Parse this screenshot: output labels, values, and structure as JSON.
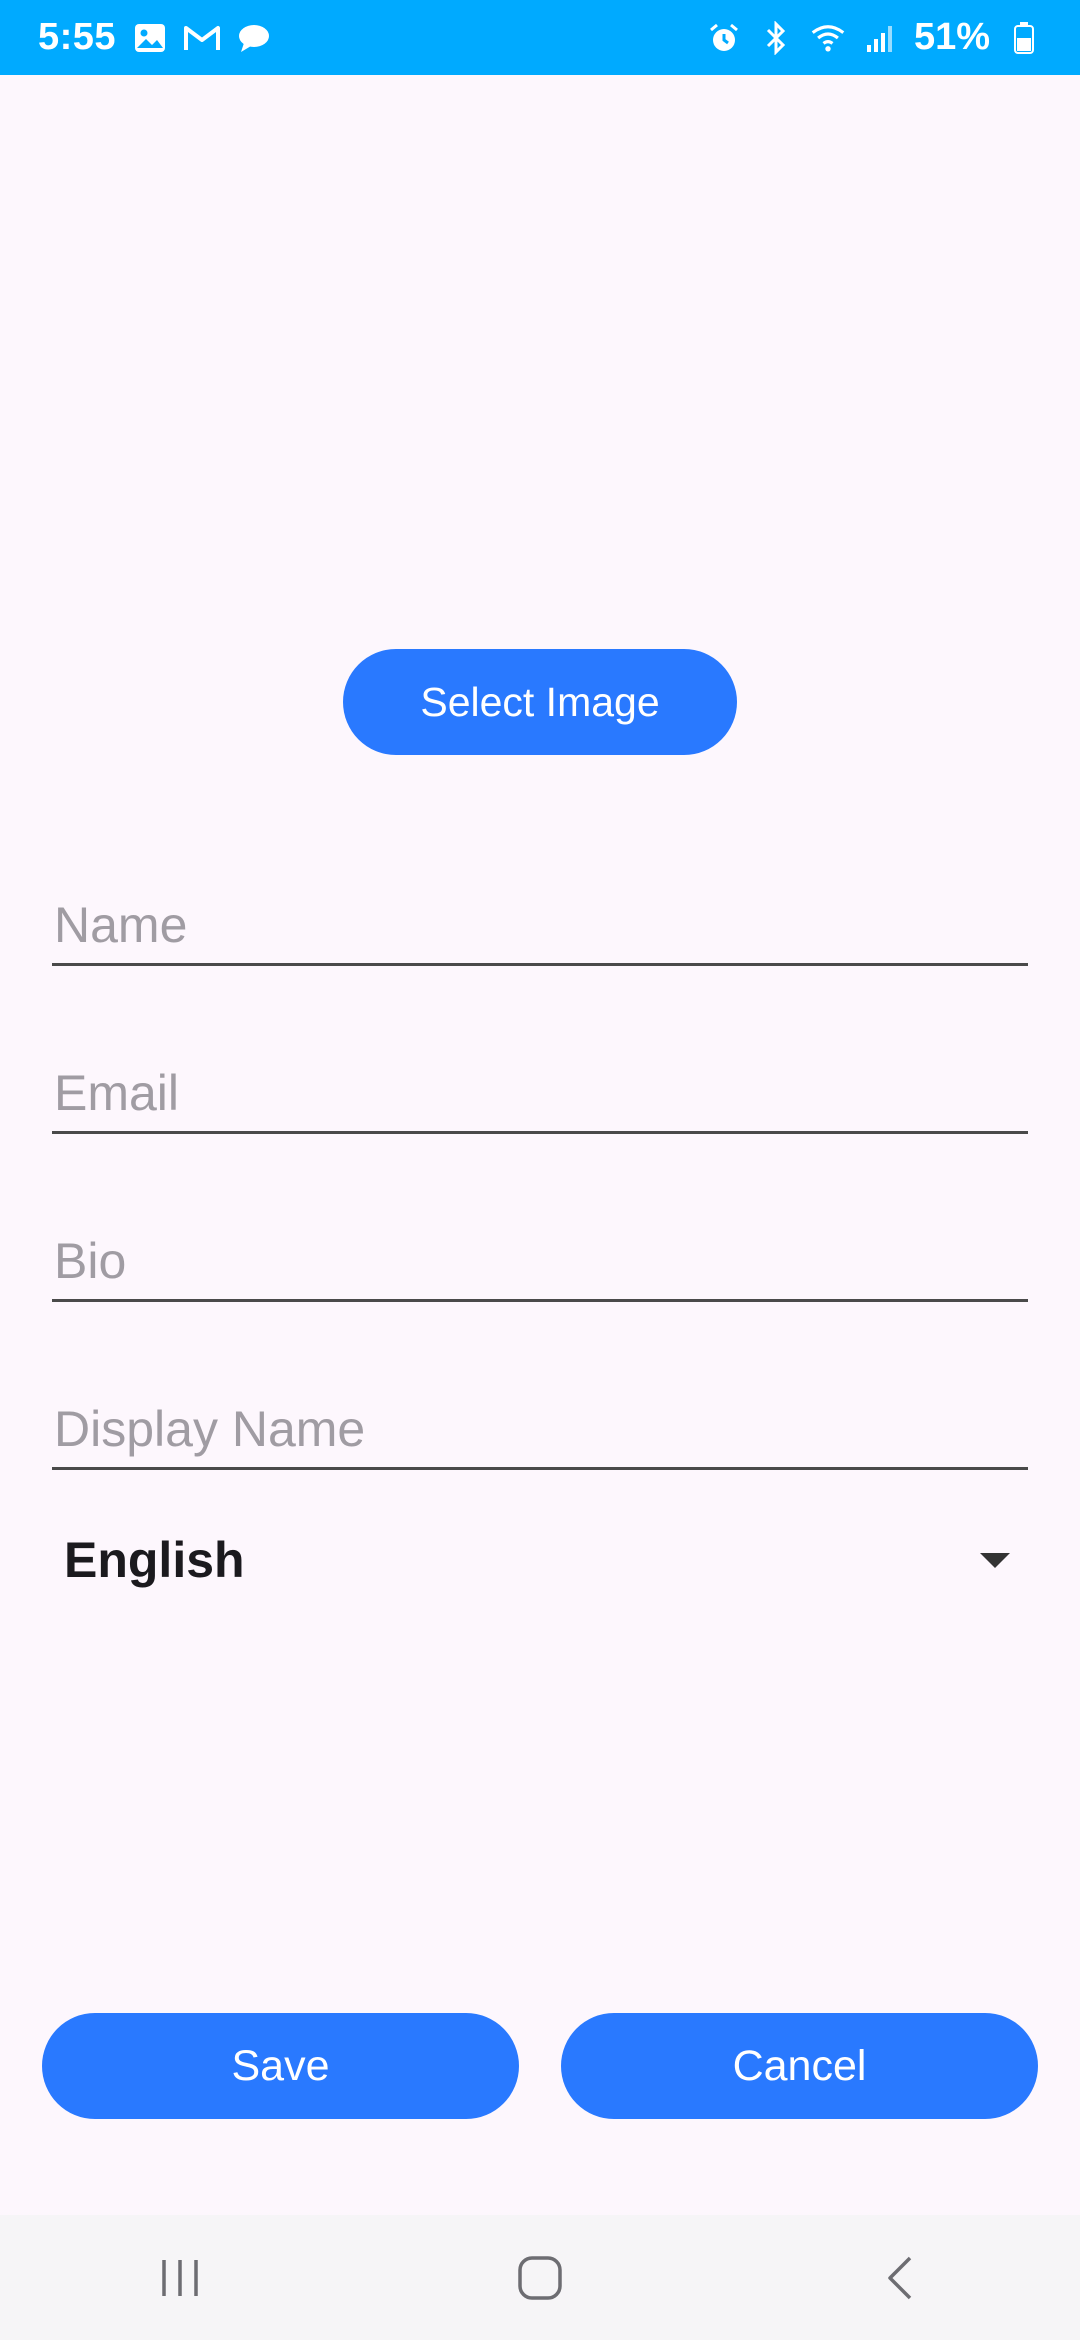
{
  "status_bar": {
    "time": "5:55",
    "battery": "51%",
    "left_icons": [
      "gallery-icon",
      "gmail-icon",
      "chat-icon"
    ],
    "right_icons": [
      "alarm-icon",
      "bluetooth-icon",
      "wifi-icon",
      "signal-icon",
      "battery-icon"
    ],
    "background_color": "#00aaff"
  },
  "form": {
    "select_image_label": "Select Image",
    "name_placeholder": "Name",
    "email_placeholder": "Email",
    "bio_placeholder": "Bio",
    "display_name_placeholder": "Display Name",
    "language_value": "English"
  },
  "actions": {
    "save_label": "Save",
    "cancel_label": "Cancel"
  },
  "colors": {
    "accent": "#2979ff",
    "background": "#fdf7fd"
  },
  "nav_bar": {
    "buttons": [
      "recent-apps-icon",
      "home-icon",
      "back-icon"
    ]
  }
}
